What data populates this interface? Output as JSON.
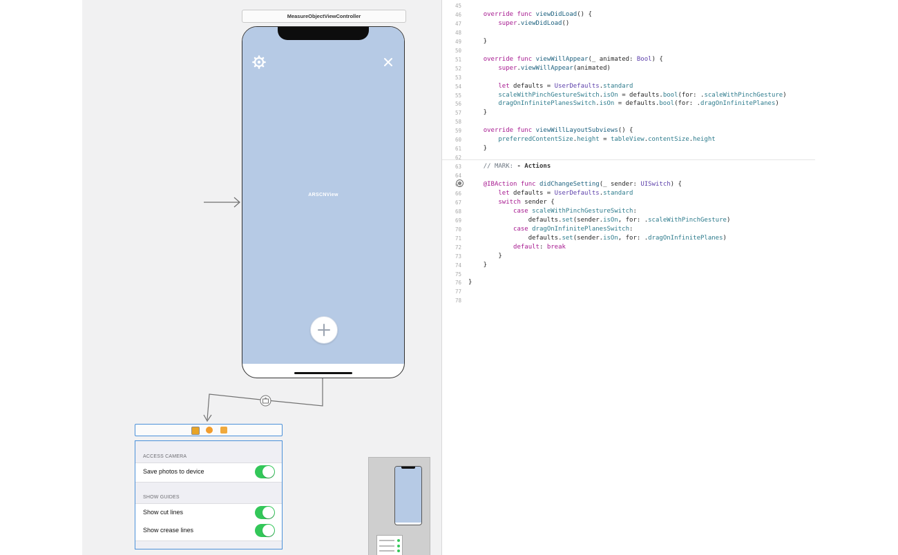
{
  "storyboard": {
    "scene_title": "MeasureObjectViewController",
    "arscn_label": "ARSCNView",
    "settings_table": {
      "sections": [
        {
          "header": "ACCESS CAMERA",
          "rows": [
            {
              "label": "Save photos to device",
              "on": true
            }
          ]
        },
        {
          "header": "SHOW GUIDES",
          "rows": [
            {
              "label": "Show cut lines",
              "on": true
            },
            {
              "label": "Show crease lines",
              "on": true
            }
          ]
        }
      ]
    },
    "icons": {
      "settings": "gear-icon",
      "close": "close-icon",
      "add": "plus-icon",
      "segue": "popover-segue-icon"
    },
    "colors": {
      "arscn_background": "#b6cae5",
      "switch_on": "#33c759",
      "selection": "#4a90d9"
    }
  },
  "code": {
    "lines": [
      {
        "n": "45",
        "src": ""
      },
      {
        "n": "46",
        "src": "    override func viewDidLoad() {"
      },
      {
        "n": "47",
        "src": "        super.viewDidLoad()"
      },
      {
        "n": "48",
        "src": ""
      },
      {
        "n": "49",
        "src": "    }"
      },
      {
        "n": "50",
        "src": ""
      },
      {
        "n": "51",
        "src": "    override func viewWillAppear(_ animated: Bool) {"
      },
      {
        "n": "52",
        "src": "        super.viewWillAppear(animated)"
      },
      {
        "n": "53",
        "src": ""
      },
      {
        "n": "54",
        "src": "        let defaults = UserDefaults.standard"
      },
      {
        "n": "55",
        "src": "        scaleWithPinchGestureSwitch.isOn = defaults.bool(for: .scaleWithPinchGesture)"
      },
      {
        "n": "56",
        "src": "        dragOnInfinitePlanesSwitch.isOn = defaults.bool(for: .dragOnInfinitePlanes)"
      },
      {
        "n": "57",
        "src": "    }"
      },
      {
        "n": "58",
        "src": ""
      },
      {
        "n": "59",
        "src": "    override func viewWillLayoutSubviews() {"
      },
      {
        "n": "60",
        "src": "        preferredContentSize.height = tableView.contentSize.height"
      },
      {
        "n": "61",
        "src": "    }"
      },
      {
        "n": "62",
        "src": ""
      },
      {
        "n": "63",
        "src": "    // MARK: - Actions"
      },
      {
        "n": "64",
        "src": ""
      },
      {
        "n": "65",
        "src": "    @IBAction func didChangeSetting(_ sender: UISwitch) {"
      },
      {
        "n": "66",
        "src": "        let defaults = UserDefaults.standard"
      },
      {
        "n": "67",
        "src": "        switch sender {"
      },
      {
        "n": "68",
        "src": "            case scaleWithPinchGestureSwitch:"
      },
      {
        "n": "69",
        "src": "                defaults.set(sender.isOn, for: .scaleWithPinchGesture)"
      },
      {
        "n": "70",
        "src": "            case dragOnInfinitePlanesSwitch:"
      },
      {
        "n": "71",
        "src": "                defaults.set(sender.isOn, for: .dragOnInfinitePlanes)"
      },
      {
        "n": "72",
        "src": "            default: break"
      },
      {
        "n": "73",
        "src": "        }"
      },
      {
        "n": "74",
        "src": "    }"
      },
      {
        "n": "75",
        "src": ""
      },
      {
        "n": "76",
        "src": "}"
      },
      {
        "n": "77",
        "src": ""
      },
      {
        "n": "78",
        "src": ""
      }
    ]
  }
}
